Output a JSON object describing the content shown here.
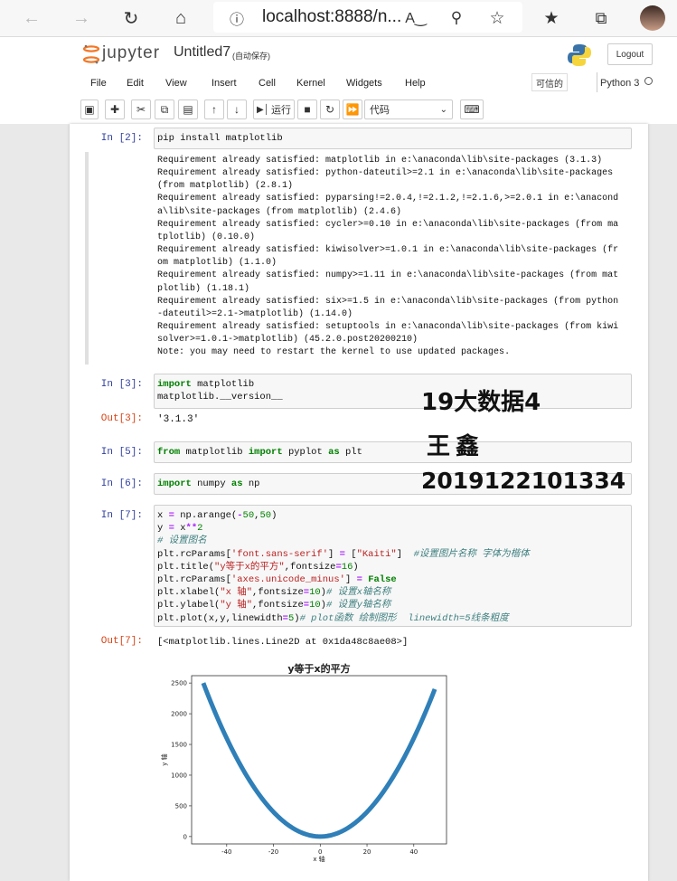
{
  "browser": {
    "url": "localhost:8888/n..."
  },
  "jupyter": {
    "logo": "jupyter",
    "notebook_title": "Untitled7",
    "autosave": "(自动保存)",
    "logout_label": "Logout",
    "trusted_label": "可信的",
    "kernel_label": "Python 3"
  },
  "menu": [
    "File",
    "Edit",
    "View",
    "Insert",
    "Cell",
    "Kernel",
    "Widgets",
    "Help"
  ],
  "toolbar": {
    "run_label": "运行",
    "cell_type": "代码"
  },
  "cells": {
    "c2": {
      "prompt": "In  [2]:",
      "code": "pip install matplotlib",
      "output": [
        "Requirement already satisfied: matplotlib in e:\\anaconda\\lib\\site-packages (3.1.3)",
        "Requirement already satisfied: python-dateutil>=2.1 in e:\\anaconda\\lib\\site-packages",
        "(from matplotlib) (2.8.1)",
        "Requirement already satisfied: pyparsing!=2.0.4,!=2.1.2,!=2.1.6,>=2.0.1 in e:\\anacond",
        "a\\lib\\site-packages (from matplotlib) (2.4.6)",
        "Requirement already satisfied: cycler>=0.10 in e:\\anaconda\\lib\\site-packages (from ma",
        "tplotlib) (0.10.0)",
        "Requirement already satisfied: kiwisolver>=1.0.1 in e:\\anaconda\\lib\\site-packages (fr",
        "om matplotlib) (1.1.0)",
        "Requirement already satisfied: numpy>=1.11 in e:\\anaconda\\lib\\site-packages (from mat",
        "plotlib) (1.18.1)",
        "Requirement already satisfied: six>=1.5 in e:\\anaconda\\lib\\site-packages (from python",
        "-dateutil>=2.1->matplotlib) (1.14.0)",
        "Requirement already satisfied: setuptools in e:\\anaconda\\lib\\site-packages (from kiwi",
        "solver>=1.0.1->matplotlib) (45.2.0.post20200210)",
        "Note: you may need to restart the kernel to use updated packages."
      ]
    },
    "c3": {
      "prompt": "In  [3]:",
      "out_prompt": "Out[3]:",
      "output": "'3.1.3'"
    },
    "c5": {
      "prompt": "In  [5]:"
    },
    "c6": {
      "prompt": "In  [6]:"
    },
    "c7": {
      "prompt": "In  [7]:",
      "out_prompt": "Out[7]:",
      "output": "[<matplotlib.lines.Line2D at 0x1da48c8ae08>]"
    }
  },
  "overlay": {
    "line1": "19大数据4",
    "line2": "王鑫",
    "line3": "2019122101334"
  },
  "chart_data": {
    "type": "line",
    "title": "y等于x的平方",
    "xlabel": "x 轴",
    "ylabel": "y 轴",
    "x_range": [
      -50,
      49
    ],
    "formula": "y = x**2",
    "x": [
      -50,
      -45,
      -40,
      -35,
      -30,
      -25,
      -20,
      -15,
      -10,
      -5,
      0,
      5,
      10,
      15,
      20,
      25,
      30,
      35,
      40,
      45,
      49
    ],
    "y": [
      2500,
      2025,
      1600,
      1225,
      900,
      625,
      400,
      225,
      100,
      25,
      0,
      25,
      100,
      225,
      400,
      625,
      900,
      1225,
      1600,
      2025,
      2401
    ],
    "xlim": [
      -55,
      54
    ],
    "ylim": [
      -120,
      2620
    ],
    "xticks": [
      -40,
      -20,
      0,
      20,
      40
    ],
    "yticks": [
      0,
      500,
      1000,
      1500,
      2000,
      2500
    ],
    "line_color": "#2f7fb8",
    "grid": false
  },
  "colors": {
    "in_prompt": "#303f9f",
    "out_prompt": "#d84315",
    "keyword": "#008000",
    "string": "#ba2121",
    "comment": "#408080"
  }
}
